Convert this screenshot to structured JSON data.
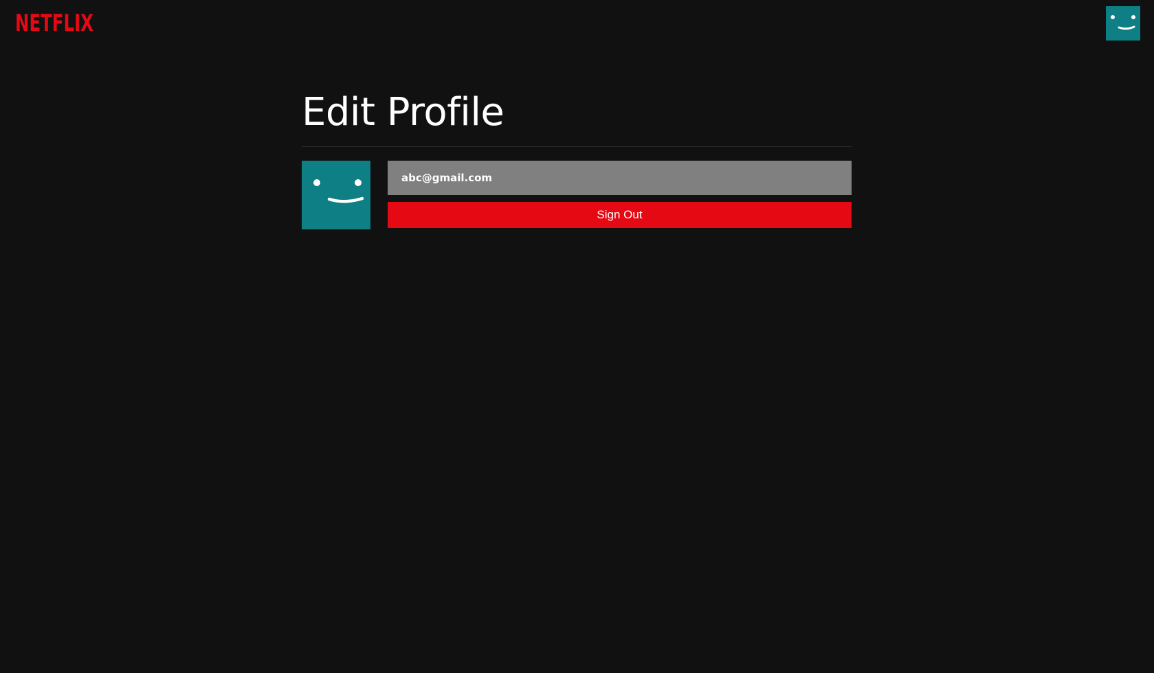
{
  "brand": {
    "logo_text": "NETFLIX",
    "logo_color": "#e50914"
  },
  "nav": {
    "avatar_icon": "smiley-face-icon",
    "avatar_color": "#0e7f84"
  },
  "profile_screen": {
    "title": "Edit Profile",
    "avatar_icon": "smiley-face-icon",
    "email": "abc@gmail.com",
    "sign_out_label": "Sign Out",
    "sign_out_color": "#e50914",
    "email_field_color": "#808080"
  },
  "theme": {
    "background": "#111111"
  }
}
